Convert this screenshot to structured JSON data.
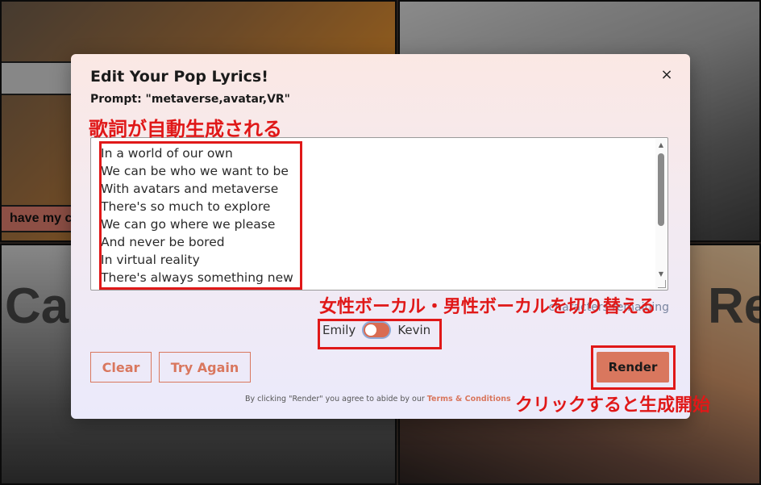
{
  "background": {
    "tile1_pill": "have my c",
    "tile3_word": "Ca",
    "tile4_word": "Re"
  },
  "modal": {
    "title": "Edit Your Pop Lyrics!",
    "prompt": "Prompt: \"metaverse,avatar,VR\"",
    "close_icon": "×",
    "lyrics": "In a world of our own\nWe can be who we want to be\nWith avatars and metaverse\nThere's so much to explore\nWe can go where we please\nAnd never be bored\nIn virtual reality\nThere's always something new",
    "remaining_text": "characters remaining",
    "voice_left": "Emily",
    "voice_right": "Kevin",
    "clear_label": "Clear",
    "try_again_label": "Try Again",
    "render_label": "Render",
    "terms_prefix": "By clicking \"Render\" you agree to abide by our ",
    "terms_link": "Terms & Conditions"
  },
  "annotations": {
    "lyrics_note": "歌詞が自動生成される",
    "voice_note": "女性ボーカル・男性ボーカルを切り替える",
    "render_note": "クリックすると生成開始"
  },
  "colors": {
    "accent": "#d9775e",
    "annotation_red": "#e01818"
  }
}
